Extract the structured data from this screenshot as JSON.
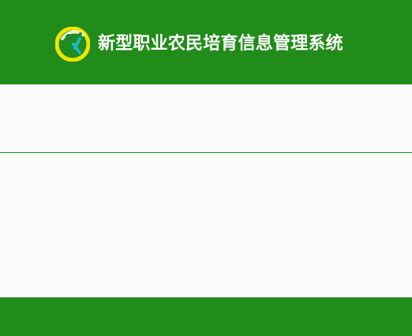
{
  "app": {
    "title": "新型职业农民培育信息管理系统",
    "logo_icon": "green-yellow-circular-person-logo-icon"
  },
  "colors": {
    "brand_green": "#218c1a",
    "background": "#fbfbfb",
    "title_text": "#ffffff",
    "logo_yellow": "#f2e600",
    "logo_green": "#1b8d2b",
    "logo_cyan": "#19b7c9"
  }
}
